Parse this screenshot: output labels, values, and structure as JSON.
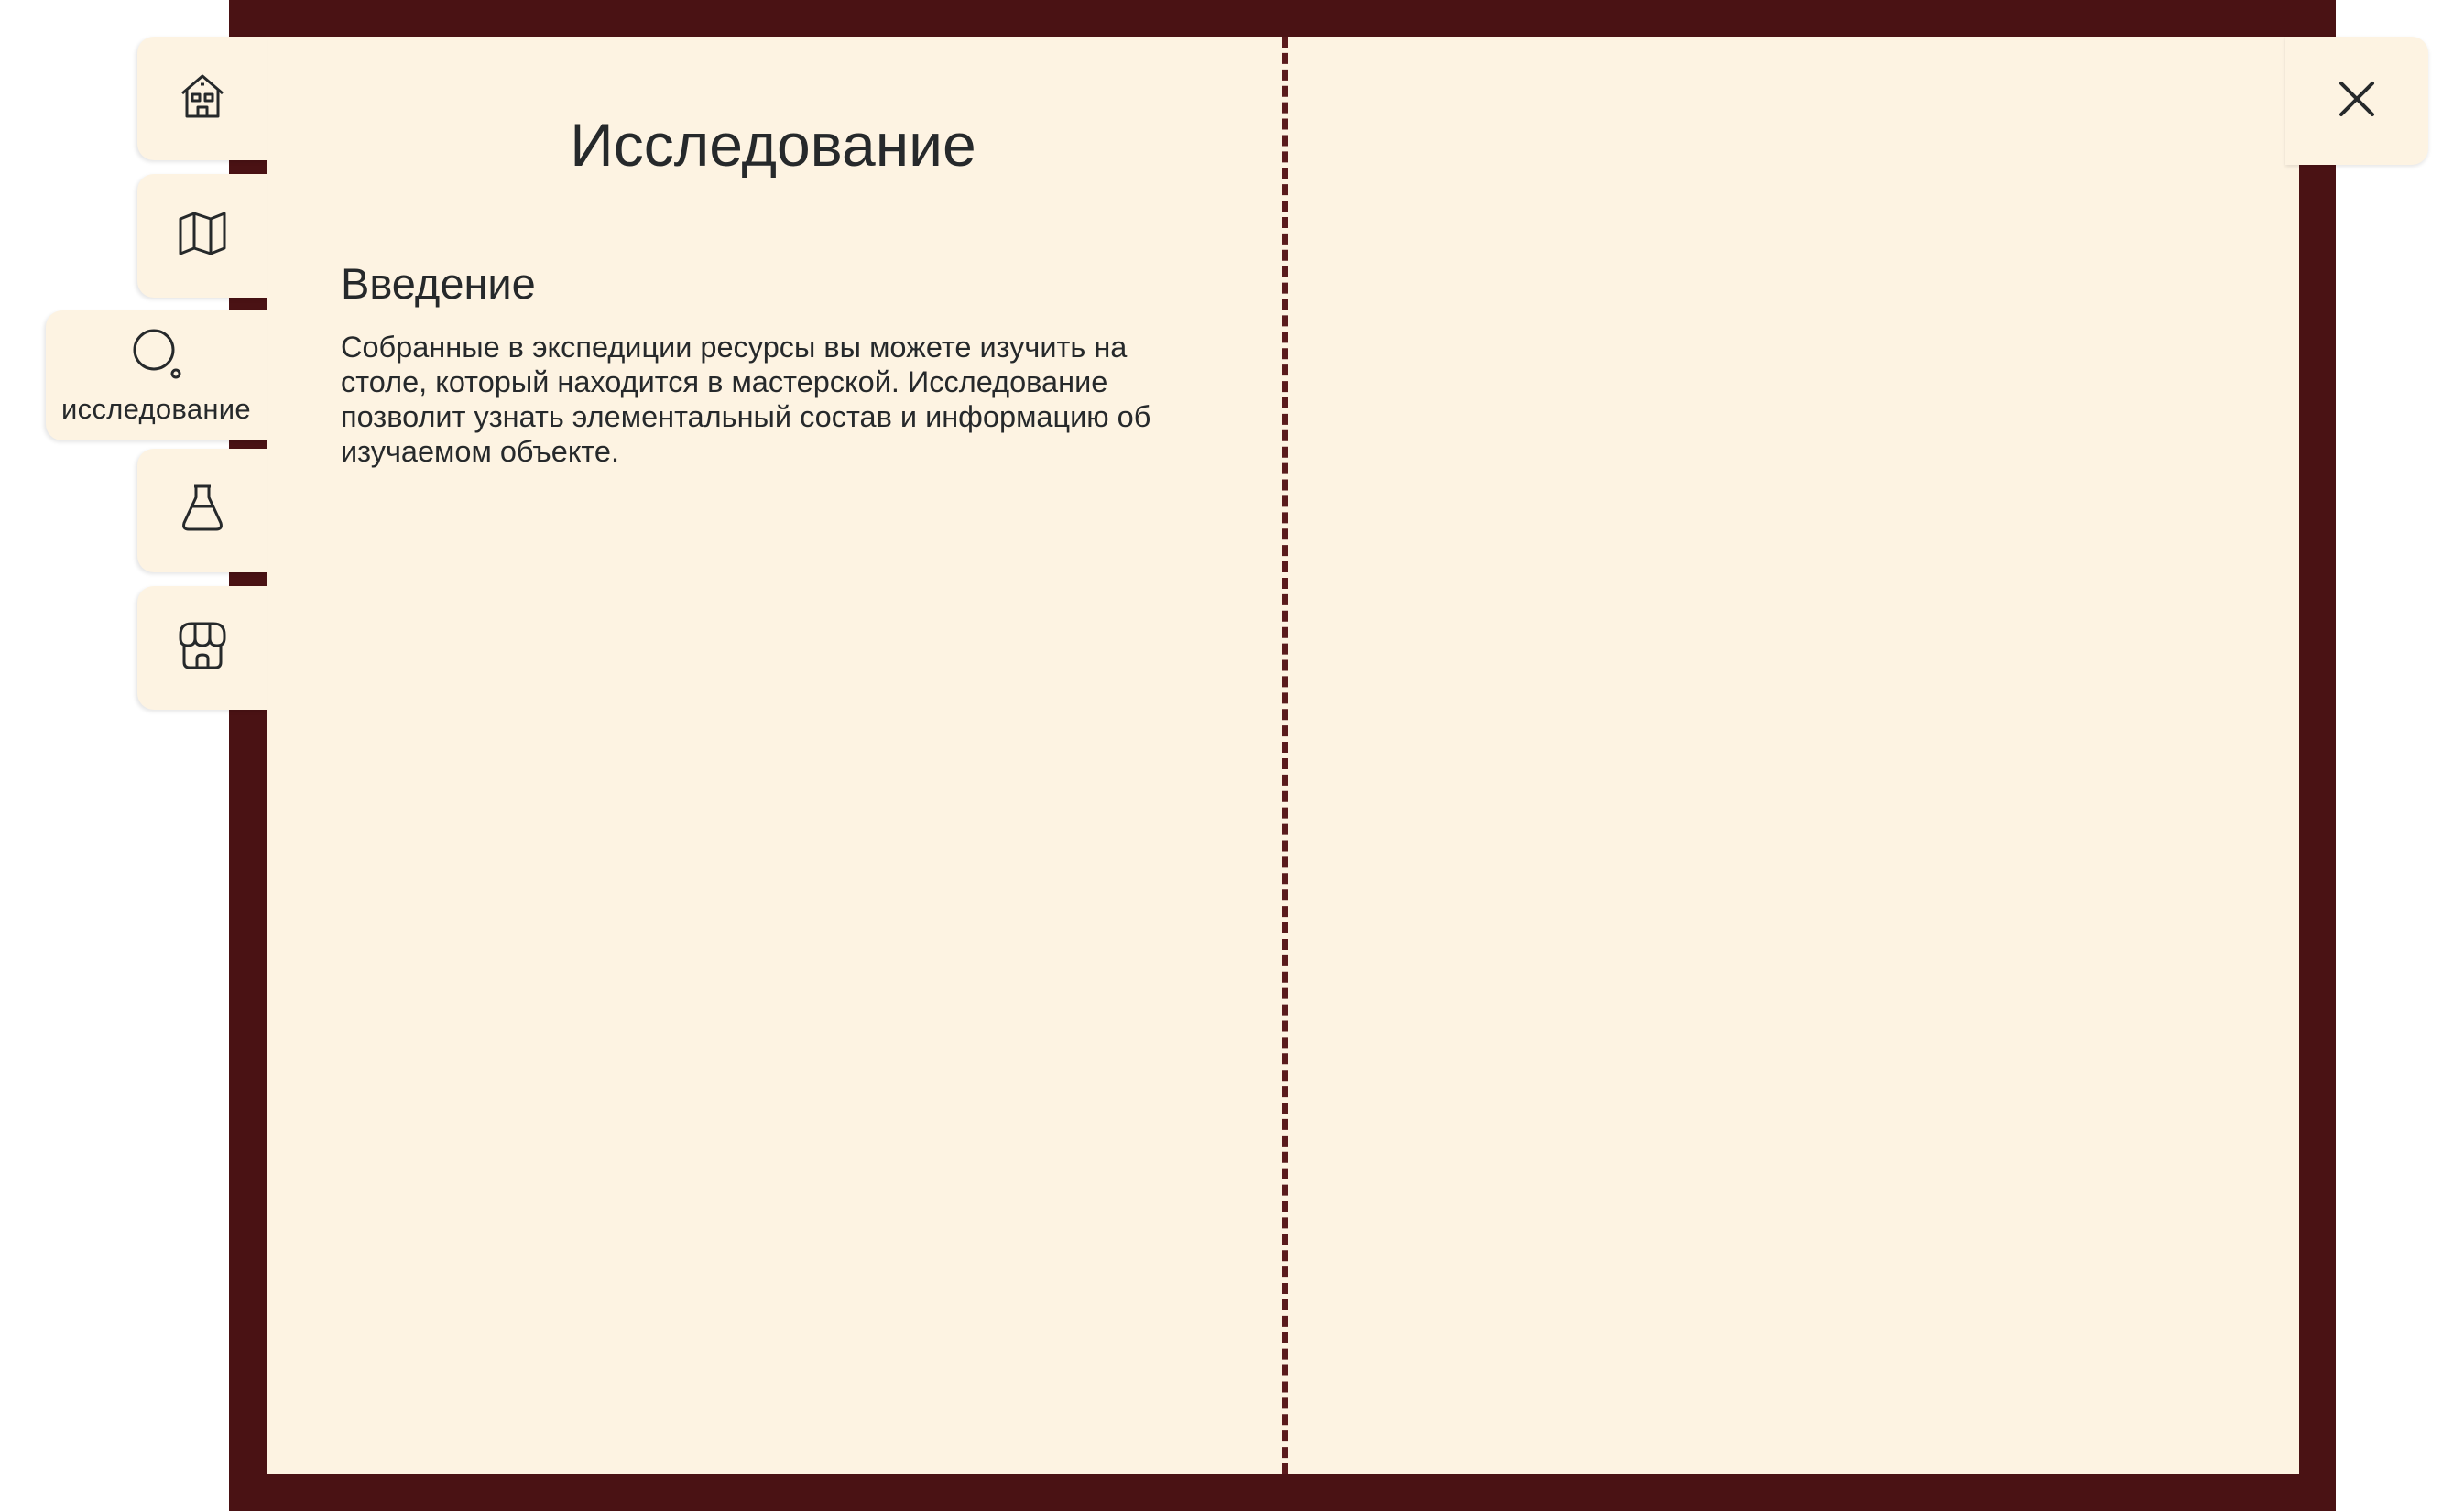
{
  "colors": {
    "cover": "#4a1214",
    "page": "#fdf3e2",
    "text": "#26292b"
  },
  "sidebar": {
    "tabs": [
      {
        "icon": "home-icon",
        "label": ""
      },
      {
        "icon": "map-icon",
        "label": ""
      },
      {
        "icon": "magnifier-icon",
        "label": "исследование",
        "active": true
      },
      {
        "icon": "flask-icon",
        "label": ""
      },
      {
        "icon": "shop-icon",
        "label": ""
      }
    ]
  },
  "page": {
    "title": "Исследование",
    "section_title": "Введение",
    "paragraph": "Собранные в экспедиции ресурсы вы можете изучить на столе, который находится в мастерской. Исследование позволит узнать элементальный состав и информацию об изучаемом объекте."
  },
  "close": {
    "icon": "close-icon"
  }
}
